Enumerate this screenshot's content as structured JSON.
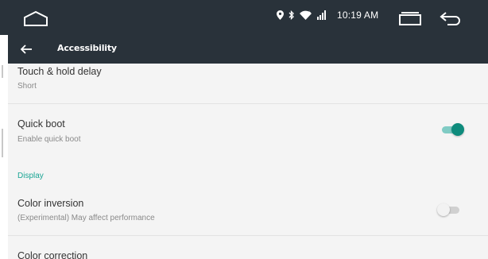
{
  "status_bar": {
    "time": "10:19 AM",
    "icons": [
      "location-icon",
      "bluetooth-icon",
      "wifi-icon",
      "signal-icon"
    ]
  },
  "app_bar": {
    "title": "Accessibility"
  },
  "preferences": [
    {
      "title": "Touch & hold delay",
      "summary": "Short"
    },
    {
      "title": "Quick boot",
      "summary": "Enable quick boot",
      "switch_on": true
    },
    {
      "category": "Display"
    },
    {
      "title": "Color inversion",
      "summary": "(Experimental) May affect performance",
      "switch_on": false
    },
    {
      "title": "Color correction"
    }
  ],
  "colors": {
    "bar": "#29323a",
    "accent": "#0e8b7c",
    "category": "#1aa594"
  }
}
